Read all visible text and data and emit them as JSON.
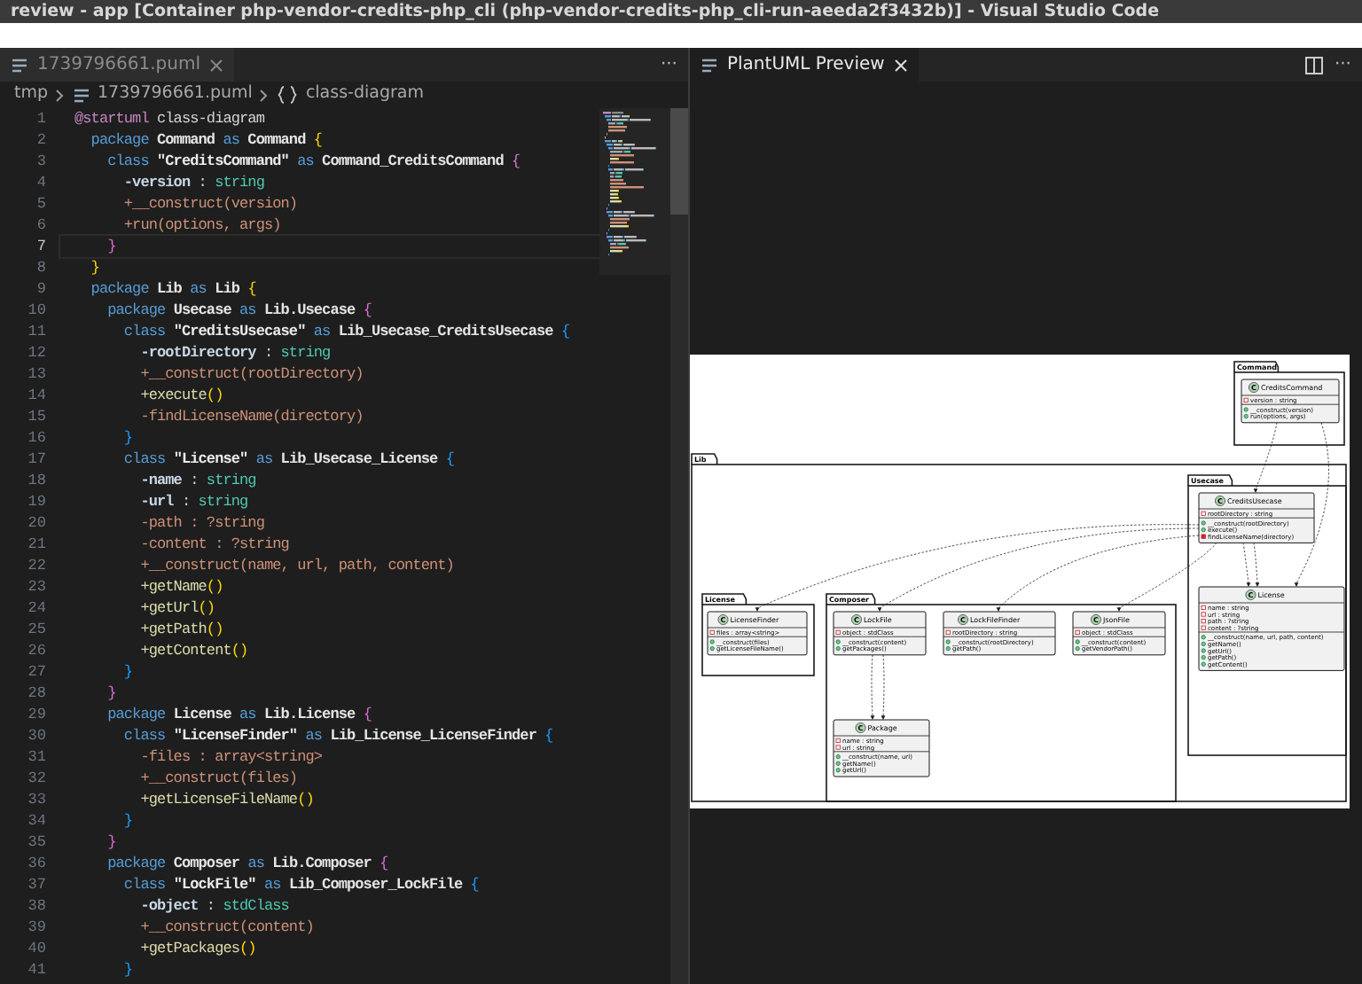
{
  "window": {
    "title": "review - app [Container php-vendor-credits-php_cli (php-vendor-credits-php_cli-run-aeeda2f3432b)] - Visual Studio Code"
  },
  "editor": {
    "tabs": [
      {
        "label": "1739796661.puml",
        "selected": false
      }
    ],
    "more": "···",
    "breadcrumb": [
      {
        "kind": "folder",
        "text": "tmp"
      },
      {
        "kind": "file",
        "text": "1739796661.puml"
      },
      {
        "kind": "symbol",
        "text": "class-diagram"
      }
    ],
    "lines": [
      {
        "number": "1",
        "current": false,
        "tokens": [
          {
            "text": "@startuml",
            "kind": "ann"
          },
          {
            "text": " class-diagram",
            "kind": "plain"
          }
        ]
      },
      {
        "number": "2",
        "current": false,
        "tokens": [
          {
            "text": "  package",
            "kind": "kw"
          },
          {
            "text": " Command ",
            "kind": "id"
          },
          {
            "text": "as",
            "kind": "kw"
          },
          {
            "text": " Command ",
            "kind": "id"
          },
          {
            "text": "{",
            "kind": "b1"
          }
        ]
      },
      {
        "number": "3",
        "current": false,
        "tokens": [
          {
            "text": "    class",
            "kind": "kw"
          },
          {
            "text": " \"CreditsCommand\" ",
            "kind": "str"
          },
          {
            "text": "as",
            "kind": "kw"
          },
          {
            "text": " Command_CreditsCommand ",
            "kind": "id"
          },
          {
            "text": "{",
            "kind": "b2"
          }
        ]
      },
      {
        "number": "4",
        "current": false,
        "tokens": [
          {
            "text": "      -version",
            "kind": "field"
          },
          {
            "text": " : ",
            "kind": "plain"
          },
          {
            "text": "string",
            "kind": "type"
          }
        ]
      },
      {
        "number": "5",
        "current": false,
        "tokens": [
          {
            "text": "      +__construct(version)",
            "kind": "method"
          }
        ]
      },
      {
        "number": "6",
        "current": false,
        "tokens": [
          {
            "text": "      +run(options, args)",
            "kind": "method"
          }
        ]
      },
      {
        "number": "7",
        "current": true,
        "tokens": [
          {
            "text": "    }",
            "kind": "b2"
          }
        ]
      },
      {
        "number": "8",
        "current": false,
        "tokens": [
          {
            "text": "  }",
            "kind": "b1"
          }
        ]
      },
      {
        "number": "9",
        "current": false,
        "tokens": [
          {
            "text": "  package",
            "kind": "kw"
          },
          {
            "text": " Lib ",
            "kind": "id"
          },
          {
            "text": "as",
            "kind": "kw"
          },
          {
            "text": " Lib ",
            "kind": "id"
          },
          {
            "text": "{",
            "kind": "b1"
          }
        ]
      },
      {
        "number": "10",
        "current": false,
        "tokens": [
          {
            "text": "    package",
            "kind": "kw"
          },
          {
            "text": " Usecase ",
            "kind": "id"
          },
          {
            "text": "as",
            "kind": "kw"
          },
          {
            "text": " Lib.Usecase ",
            "kind": "id"
          },
          {
            "text": "{",
            "kind": "b2"
          }
        ]
      },
      {
        "number": "11",
        "current": false,
        "tokens": [
          {
            "text": "      class",
            "kind": "kw"
          },
          {
            "text": " \"CreditsUsecase\" ",
            "kind": "str"
          },
          {
            "text": "as",
            "kind": "kw"
          },
          {
            "text": " Lib_Usecase_CreditsUsecase ",
            "kind": "id"
          },
          {
            "text": "{",
            "kind": "b3"
          }
        ]
      },
      {
        "number": "12",
        "current": false,
        "tokens": [
          {
            "text": "        -rootDirectory",
            "kind": "field"
          },
          {
            "text": " : ",
            "kind": "plain"
          },
          {
            "text": "string",
            "kind": "type"
          }
        ]
      },
      {
        "number": "13",
        "current": false,
        "tokens": [
          {
            "text": "        +__construct(rootDirectory)",
            "kind": "method"
          }
        ]
      },
      {
        "number": "14",
        "current": false,
        "tokens": [
          {
            "text": "        +execute",
            "kind": "fn"
          },
          {
            "text": "()",
            "kind": "b1"
          }
        ]
      },
      {
        "number": "15",
        "current": false,
        "tokens": [
          {
            "text": "        -findLicenseName(directory)",
            "kind": "method"
          }
        ]
      },
      {
        "number": "16",
        "current": false,
        "tokens": [
          {
            "text": "      }",
            "kind": "b3"
          }
        ]
      },
      {
        "number": "17",
        "current": false,
        "tokens": [
          {
            "text": "      class",
            "kind": "kw"
          },
          {
            "text": " \"License\" ",
            "kind": "str"
          },
          {
            "text": "as",
            "kind": "kw"
          },
          {
            "text": " Lib_Usecase_License ",
            "kind": "id"
          },
          {
            "text": "{",
            "kind": "b3"
          }
        ]
      },
      {
        "number": "18",
        "current": false,
        "tokens": [
          {
            "text": "        -name",
            "kind": "field"
          },
          {
            "text": " : ",
            "kind": "plain"
          },
          {
            "text": "string",
            "kind": "type"
          }
        ]
      },
      {
        "number": "19",
        "current": false,
        "tokens": [
          {
            "text": "        -url",
            "kind": "field"
          },
          {
            "text": " : ",
            "kind": "plain"
          },
          {
            "text": "string",
            "kind": "type"
          }
        ]
      },
      {
        "number": "20",
        "current": false,
        "tokens": [
          {
            "text": "        -path : ?string",
            "kind": "method"
          }
        ]
      },
      {
        "number": "21",
        "current": false,
        "tokens": [
          {
            "text": "        -content : ?string",
            "kind": "method"
          }
        ]
      },
      {
        "number": "22",
        "current": false,
        "tokens": [
          {
            "text": "        +__construct(name, url, path, content)",
            "kind": "method"
          }
        ]
      },
      {
        "number": "23",
        "current": false,
        "tokens": [
          {
            "text": "        +getName",
            "kind": "fn"
          },
          {
            "text": "()",
            "kind": "b1"
          }
        ]
      },
      {
        "number": "24",
        "current": false,
        "tokens": [
          {
            "text": "        +getUrl",
            "kind": "fn"
          },
          {
            "text": "()",
            "kind": "b1"
          }
        ]
      },
      {
        "number": "25",
        "current": false,
        "tokens": [
          {
            "text": "        +getPath",
            "kind": "fn"
          },
          {
            "text": "()",
            "kind": "b1"
          }
        ]
      },
      {
        "number": "26",
        "current": false,
        "tokens": [
          {
            "text": "        +getContent",
            "kind": "fn"
          },
          {
            "text": "()",
            "kind": "b1"
          }
        ]
      },
      {
        "number": "27",
        "current": false,
        "tokens": [
          {
            "text": "      }",
            "kind": "b3"
          }
        ]
      },
      {
        "number": "28",
        "current": false,
        "tokens": [
          {
            "text": "    }",
            "kind": "b2"
          }
        ]
      },
      {
        "number": "29",
        "current": false,
        "tokens": [
          {
            "text": "    package",
            "kind": "kw"
          },
          {
            "text": " License ",
            "kind": "id"
          },
          {
            "text": "as",
            "kind": "kw"
          },
          {
            "text": " Lib.License ",
            "kind": "id"
          },
          {
            "text": "{",
            "kind": "b2"
          }
        ]
      },
      {
        "number": "30",
        "current": false,
        "tokens": [
          {
            "text": "      class",
            "kind": "kw"
          },
          {
            "text": " \"LicenseFinder\" ",
            "kind": "str"
          },
          {
            "text": "as",
            "kind": "kw"
          },
          {
            "text": " Lib_License_LicenseFinder ",
            "kind": "id"
          },
          {
            "text": "{",
            "kind": "b3"
          }
        ]
      },
      {
        "number": "31",
        "current": false,
        "tokens": [
          {
            "text": "        -files : array<string>",
            "kind": "method"
          }
        ]
      },
      {
        "number": "32",
        "current": false,
        "tokens": [
          {
            "text": "        +__construct(files)",
            "kind": "method"
          }
        ]
      },
      {
        "number": "33",
        "current": false,
        "tokens": [
          {
            "text": "        +getLicenseFileName",
            "kind": "fn"
          },
          {
            "text": "()",
            "kind": "b1"
          }
        ]
      },
      {
        "number": "34",
        "current": false,
        "tokens": [
          {
            "text": "      }",
            "kind": "b3"
          }
        ]
      },
      {
        "number": "35",
        "current": false,
        "tokens": [
          {
            "text": "    }",
            "kind": "b2"
          }
        ]
      },
      {
        "number": "36",
        "current": false,
        "tokens": [
          {
            "text": "    package",
            "kind": "kw"
          },
          {
            "text": " Composer ",
            "kind": "id"
          },
          {
            "text": "as",
            "kind": "kw"
          },
          {
            "text": " Lib.Composer ",
            "kind": "id"
          },
          {
            "text": "{",
            "kind": "b2"
          }
        ]
      },
      {
        "number": "37",
        "current": false,
        "tokens": [
          {
            "text": "      class",
            "kind": "kw"
          },
          {
            "text": " \"LockFile\" ",
            "kind": "str"
          },
          {
            "text": "as",
            "kind": "kw"
          },
          {
            "text": " Lib_Composer_LockFile ",
            "kind": "id"
          },
          {
            "text": "{",
            "kind": "b3"
          }
        ]
      },
      {
        "number": "38",
        "current": false,
        "tokens": [
          {
            "text": "        -object",
            "kind": "field"
          },
          {
            "text": " : ",
            "kind": "plain"
          },
          {
            "text": "stdClass",
            "kind": "type"
          }
        ]
      },
      {
        "number": "39",
        "current": false,
        "tokens": [
          {
            "text": "        +__construct(content)",
            "kind": "method"
          }
        ]
      },
      {
        "number": "40",
        "current": false,
        "tokens": [
          {
            "text": "        +getPackages",
            "kind": "fn"
          },
          {
            "text": "()",
            "kind": "b1"
          }
        ]
      },
      {
        "number": "41",
        "current": false,
        "tokens": [
          {
            "text": "      }",
            "kind": "b3"
          }
        ]
      }
    ]
  },
  "preview": {
    "tabs": [
      {
        "label": "PlantUML Preview",
        "selected": true
      }
    ],
    "more": "···",
    "diagram": {
      "packages": [
        {
          "name": "Command",
          "classes": [
            {
              "badge": "C",
              "name": "CreditsCommand",
              "fields": [
                {
                  "private": true,
                  "text": "version : string"
                }
              ],
              "methods": [
                {
                  "private": false,
                  "text": "__construct(version)"
                },
                {
                  "private": false,
                  "text": "run(options, args)"
                }
              ]
            }
          ]
        },
        {
          "name": "Lib",
          "children": [
            {
              "name": "Usecase",
              "classes": [
                {
                  "badge": "C",
                  "name": "CreditsUsecase",
                  "fields": [
                    {
                      "private": true,
                      "text": "rootDirectory : string"
                    }
                  ],
                  "methods": [
                    {
                      "private": false,
                      "text": "__construct(rootDirectory)"
                    },
                    {
                      "private": false,
                      "text": "execute()"
                    },
                    {
                      "private": true,
                      "text": "findLicenseName(directory)"
                    }
                  ]
                },
                {
                  "badge": "C",
                  "name": "License",
                  "fields": [
                    {
                      "private": true,
                      "text": "name : string"
                    },
                    {
                      "private": true,
                      "text": "url : string"
                    },
                    {
                      "private": true,
                      "text": "path : ?string"
                    },
                    {
                      "private": true,
                      "text": "content : ?string"
                    }
                  ],
                  "methods": [
                    {
                      "private": false,
                      "text": "__construct(name, url, path, content)"
                    },
                    {
                      "private": false,
                      "text": "getName()"
                    },
                    {
                      "private": false,
                      "text": "getUrl()"
                    },
                    {
                      "private": false,
                      "text": "getPath()"
                    },
                    {
                      "private": false,
                      "text": "getContent()"
                    }
                  ]
                }
              ]
            },
            {
              "name": "License",
              "classes": [
                {
                  "badge": "C",
                  "name": "LicenseFinder",
                  "fields": [
                    {
                      "private": true,
                      "text": "files : array<string>"
                    }
                  ],
                  "methods": [
                    {
                      "private": false,
                      "text": "__construct(files)"
                    },
                    {
                      "private": false,
                      "text": "getLicenseFileName()"
                    }
                  ]
                }
              ]
            },
            {
              "name": "Composer",
              "classes": [
                {
                  "badge": "C",
                  "name": "LockFile",
                  "fields": [
                    {
                      "private": true,
                      "text": "object : stdClass"
                    }
                  ],
                  "methods": [
                    {
                      "private": false,
                      "text": "__construct(content)"
                    },
                    {
                      "private": false,
                      "text": "getPackages()"
                    }
                  ]
                },
                {
                  "badge": "C",
                  "name": "LockFileFinder",
                  "fields": [
                    {
                      "private": true,
                      "text": "rootDirectory : string"
                    }
                  ],
                  "methods": [
                    {
                      "private": false,
                      "text": "__construct(rootDirectory)"
                    },
                    {
                      "private": false,
                      "text": "getPath()"
                    }
                  ]
                },
                {
                  "badge": "C",
                  "name": "JsonFile",
                  "fields": [
                    {
                      "private": true,
                      "text": "object : stdClass"
                    }
                  ],
                  "methods": [
                    {
                      "private": false,
                      "text": "__construct(content)"
                    },
                    {
                      "private": false,
                      "text": "getVendorPath()"
                    }
                  ]
                },
                {
                  "badge": "C",
                  "name": "Package",
                  "fields": [
                    {
                      "private": true,
                      "text": "name : string"
                    },
                    {
                      "private": true,
                      "text": "url : string"
                    }
                  ],
                  "methods": [
                    {
                      "private": false,
                      "text": "__construct(name, url)"
                    },
                    {
                      "private": false,
                      "text": "getName()"
                    },
                    {
                      "private": false,
                      "text": "getUrl()"
                    }
                  ]
                }
              ]
            }
          ]
        }
      ]
    }
  }
}
